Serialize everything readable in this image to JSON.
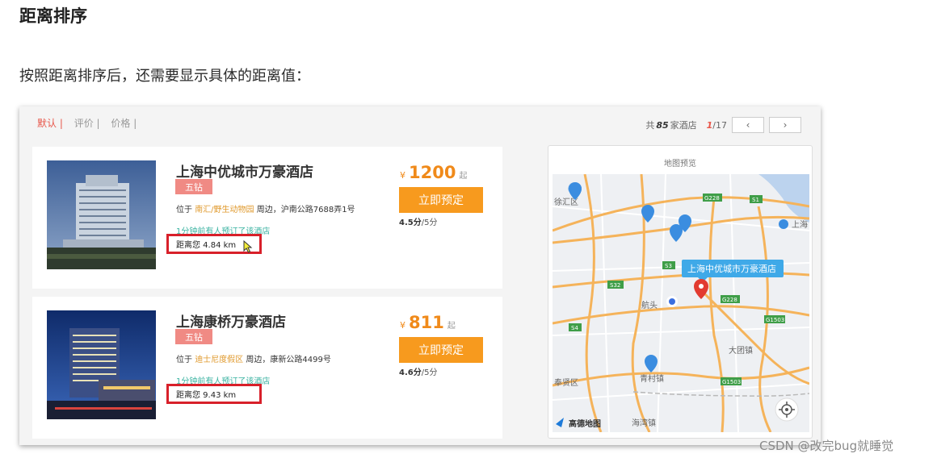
{
  "article": {
    "heading": "距离排序",
    "intro": "按照距离排序后，还需要显示具体的距离值："
  },
  "sort": {
    "default": "默认 |",
    "rating": "评价 |",
    "price": "价格 |"
  },
  "pager": {
    "prefix": "共",
    "count": "85",
    "suffix": "家酒店",
    "current": "1",
    "total": "/17",
    "prev": "‹",
    "next": "›"
  },
  "hotels": [
    {
      "name": "上海中优城市万豪酒店",
      "badge": "五钻",
      "addr_prefix": "位于",
      "area": "南汇/野生动物园",
      "addr_suffix": "周边，沪南公路7688弄1号",
      "booked": "1分钟前有人预订了该酒店",
      "distance": "距离您 4.84 km",
      "currency": "¥",
      "price": "1200",
      "price_suffix": "起",
      "book_label": "立即预定",
      "score": "4.5分",
      "score_max": "/5分"
    },
    {
      "name": "上海康桥万豪酒店",
      "badge": "五钻",
      "addr_prefix": "位于",
      "area": "迪士尼度假区",
      "addr_suffix": "周边，康新公路4499号",
      "booked": "1分钟前有人预订了该酒店",
      "distance": "距离您 9.43 km",
      "currency": "¥",
      "price": "811",
      "price_suffix": "起",
      "book_label": "立即预定",
      "score": "4.6分",
      "score_max": "/5分"
    }
  ],
  "map": {
    "title": "地图预览",
    "popup": "上海中优城市万豪酒店",
    "labels": {
      "xuhui": "徐汇区",
      "shanghai": "上海",
      "hangtou": "航头",
      "datuan": "大团镇",
      "fengxian": "奉贤区",
      "qingcun": "青村镇",
      "haiwan": "海湾镇",
      "g228a": "G228",
      "s1": "S1",
      "s3": "S3",
      "s32": "S32",
      "g228b": "G228",
      "s4": "S4",
      "g1503a": "G1503",
      "g1503b": "G1503"
    },
    "brand": "高德地图",
    "colors": {
      "pin_blue": "#3b8de0",
      "pin_red": "#e23b30",
      "road_main": "#f5b35a",
      "water": "#bcd3ee"
    }
  },
  "watermark": "CSDN @改完bug就睡觉"
}
